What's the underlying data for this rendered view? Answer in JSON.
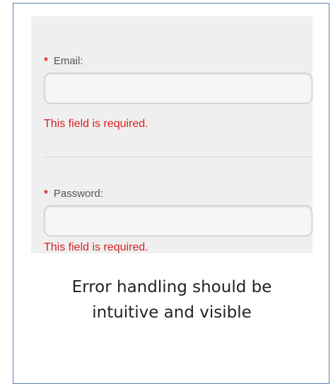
{
  "form": {
    "email": {
      "required_marker": "*",
      "label": "Email:",
      "value": "",
      "error": "This field is required."
    },
    "password": {
      "required_marker": "*",
      "label": "Password:",
      "value": "",
      "error": "This field is required."
    }
  },
  "caption": {
    "line1": "Error handling should be",
    "line2": "intuitive and visible"
  },
  "colors": {
    "error": "#d82222",
    "frame_border": "#5a80b0",
    "panel_bg": "#efefef"
  }
}
